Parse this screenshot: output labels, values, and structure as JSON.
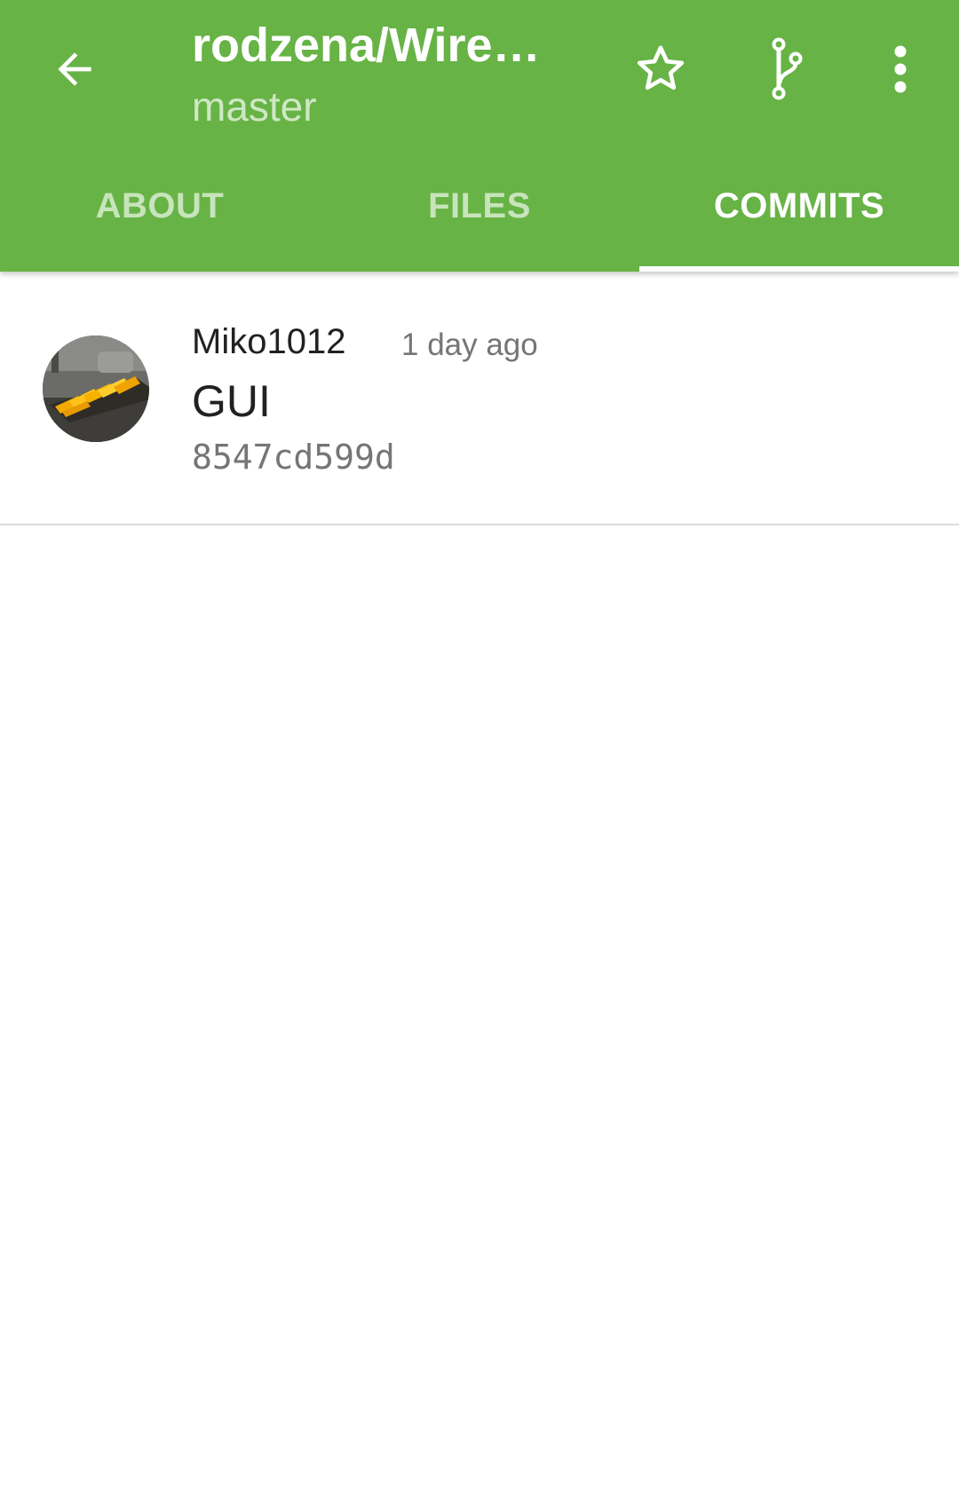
{
  "toolbar": {
    "title": "rodzena/Wire…",
    "subtitle": "master",
    "back_icon": "arrow-back-icon",
    "star_icon": "star-outline-icon",
    "branch_icon": "git-branch-icon",
    "more_icon": "more-vert-icon"
  },
  "tabs": [
    {
      "label": "ABOUT",
      "active": false
    },
    {
      "label": "FILES",
      "active": false
    },
    {
      "label": "COMMITS",
      "active": true
    }
  ],
  "commits": [
    {
      "author": "Miko1012",
      "time": "1 day ago",
      "message": "GUI",
      "sha": "8547cd599d"
    }
  ],
  "colors": {
    "primary": "#67b346",
    "tab_inactive": "#c8e4bb",
    "subtitle": "#cfe8c4",
    "text_primary": "#212121",
    "text_secondary": "#757575",
    "divider": "#dcdcdc"
  }
}
